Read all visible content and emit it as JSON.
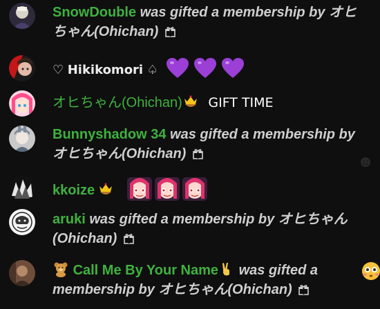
{
  "messages": [
    {
      "author": "SnowDouble",
      "text": "was gifted a membership by",
      "gifter": "オヒちゃん",
      "gifter_romaji": "(Ohichan)"
    },
    {
      "author_prefix": "♡",
      "author": "Hikikomori",
      "author_suffix": "♤"
    },
    {
      "author": "オヒちゃん(Ohichan)",
      "text": "GIFT TIME"
    },
    {
      "author": "Bunnyshadow 34",
      "text": "was gifted a membership by",
      "gifter": "オヒちゃん",
      "gifter_romaji": "(Ohichan)"
    },
    {
      "author": "kkoize"
    },
    {
      "author": "aruki",
      "text": "was gifted a membership by",
      "gifter": "オヒちゃん",
      "gifter_romaji": "(Ohichan)"
    },
    {
      "author": "Call Me By Your Name",
      "text": "was gifted a",
      "text2": "membership by",
      "gifter": "オヒちゃん",
      "gifter_romaji": "(Ohichan)"
    }
  ],
  "icons": {
    "gift": "gift-icon",
    "heart": "purple-heart-emoji",
    "crown": "crown-bowl-emoji",
    "sticker": "pink-character-sticker",
    "bear": "teddy-bear-emoji",
    "victory": "victory-hand-emoji",
    "face": "flushed-face-emoji"
  },
  "colors": {
    "background": "#0f0f0f",
    "author": "#3fb23f",
    "gift_text": "#cfcfcf",
    "heart": "#9b3fd6"
  }
}
